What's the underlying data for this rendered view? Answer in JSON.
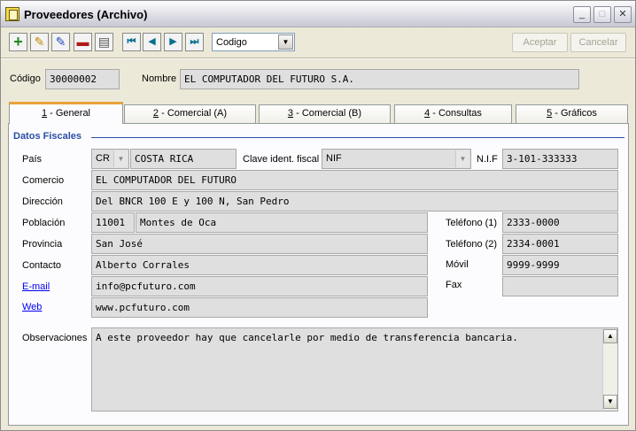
{
  "window": {
    "title": "Proveedores (Archivo)",
    "min_label": "_",
    "max_label": "□",
    "close_label": "✕"
  },
  "toolbar": {
    "order_field": "Codigo",
    "accept_label": "Aceptar",
    "cancel_label": "Cancelar",
    "icons": [
      "add-icon",
      "edit-icon",
      "find-icon",
      "delete-icon",
      "print-icon",
      "first-icon",
      "prev-icon",
      "next-icon",
      "last-icon"
    ],
    "icon_glyphs": {
      "add": "+",
      "edit": "✎",
      "find": "✎",
      "delete": "▬",
      "print": "▤",
      "first": "⏮",
      "prev": "◀",
      "next": "▶",
      "last": "⏭",
      "dropdown": "▼"
    }
  },
  "header": {
    "code_label": "Código",
    "code_value": "30000002",
    "name_label": "Nombre",
    "name_value": "EL COMPUTADOR DEL FUTURO S.A."
  },
  "tabs": [
    {
      "num": "1",
      "label": " - General"
    },
    {
      "num": "2",
      "label": " - Comercial (A)"
    },
    {
      "num": "3",
      "label": " - Comercial (B)"
    },
    {
      "num": "4",
      "label": " - Consultas"
    },
    {
      "num": "5",
      "label": " - Gráficos"
    }
  ],
  "general": {
    "section_title": "Datos Fiscales",
    "country_label": "País",
    "country_code": "CR",
    "country_name": "COSTA RICA",
    "tax_id_type_label": "Clave ident. fiscal",
    "tax_id_type": "NIF",
    "nif_label": "N.I.F",
    "nif_value": "3-101-333333",
    "trade_label": "Comercio",
    "trade_value": "EL COMPUTADOR DEL FUTURO",
    "address_label": "Dirección",
    "address_value": "Del BNCR 100 E y 100 N, San Pedro",
    "city_label": "Población",
    "postal_code": "11001",
    "city_value": "Montes de Oca",
    "phone1_label": "Teléfono (1)",
    "phone1_value": "2333-0000",
    "province_label": "Provincia",
    "province_value": "San José",
    "phone2_label": "Teléfono (2)",
    "phone2_value": "2334-0001",
    "contact_label": "Contacto",
    "contact_value": "Alberto Corrales",
    "mobile_label": "Móvil",
    "mobile_value": "9999-9999",
    "email_label": "E-mail",
    "email_value": "info@pcfuturo.com",
    "fax_label": "Fax",
    "fax_value": "",
    "web_label": "Web",
    "web_value": "www.pcfuturo.com",
    "notes_label": "Observaciones",
    "notes_value": "A este proveedor hay que cancelarle por medio de transferencia bancaria.",
    "scroll_up_glyph": "▲",
    "scroll_down_glyph": "▼"
  }
}
